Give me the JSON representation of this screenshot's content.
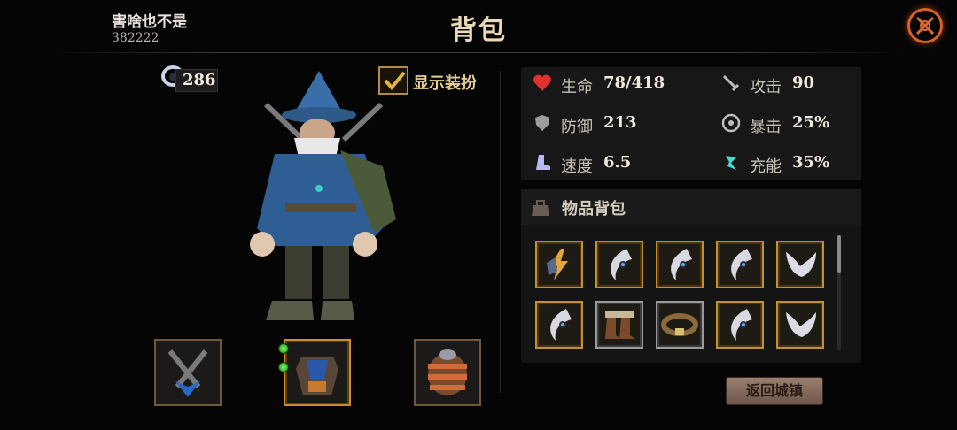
{
  "header": {
    "player_name": "害啥也不是",
    "player_id": "382222",
    "title": "背包"
  },
  "currency": {
    "amount": "286"
  },
  "costume_toggle": {
    "label": "显示装扮",
    "checked": true
  },
  "equipment_slots": [
    {
      "name": "weapon",
      "icon": "crossed-swords-icon"
    },
    {
      "name": "armor",
      "icon": "armor-icon",
      "gems": 2
    },
    {
      "name": "helmet",
      "icon": "helmet-icon"
    }
  ],
  "stats": [
    {
      "key": "hp",
      "label": "生命",
      "value": "78/418",
      "icon": "heart-icon",
      "color": "#e03030"
    },
    {
      "key": "attack",
      "label": "攻击",
      "value": "90",
      "icon": "sword-icon",
      "color": "#bcbcbc"
    },
    {
      "key": "defense",
      "label": "防御",
      "value": "213",
      "icon": "shield-icon",
      "color": "#bcbcbc"
    },
    {
      "key": "crit",
      "label": "暴击",
      "value": "25%",
      "icon": "crit-icon",
      "color": "#bcbcbc"
    },
    {
      "key": "speed",
      "label": "速度",
      "value": "6.5",
      "icon": "boot-icon",
      "color": "#b8b8f0"
    },
    {
      "key": "charge",
      "label": "充能",
      "value": "35%",
      "icon": "charge-icon",
      "color": "#4fd6d0"
    }
  ],
  "bag": {
    "title": "物品背包",
    "items": [
      {
        "icon": "lightning-gauntlet-icon",
        "rarity": "gold"
      },
      {
        "icon": "claw-blade-icon",
        "rarity": "gold"
      },
      {
        "icon": "claw-blade-icon",
        "rarity": "gold"
      },
      {
        "icon": "claw-blade-icon",
        "rarity": "gold"
      },
      {
        "icon": "fang-icon",
        "rarity": "gold"
      },
      {
        "icon": "claw-blade-icon",
        "rarity": "gold"
      },
      {
        "icon": "boots-icon",
        "rarity": "gold"
      },
      {
        "icon": "belt-icon",
        "rarity": "silver"
      },
      {
        "icon": "claw-blade-icon",
        "rarity": "gold"
      },
      {
        "icon": "fang-icon",
        "rarity": "gold"
      }
    ]
  },
  "buttons": {
    "return_town": "返回城镇"
  },
  "colors": {
    "accent_gold": "#c2922e",
    "close_orange": "#d9602a",
    "title_text": "#e9d9b4"
  }
}
